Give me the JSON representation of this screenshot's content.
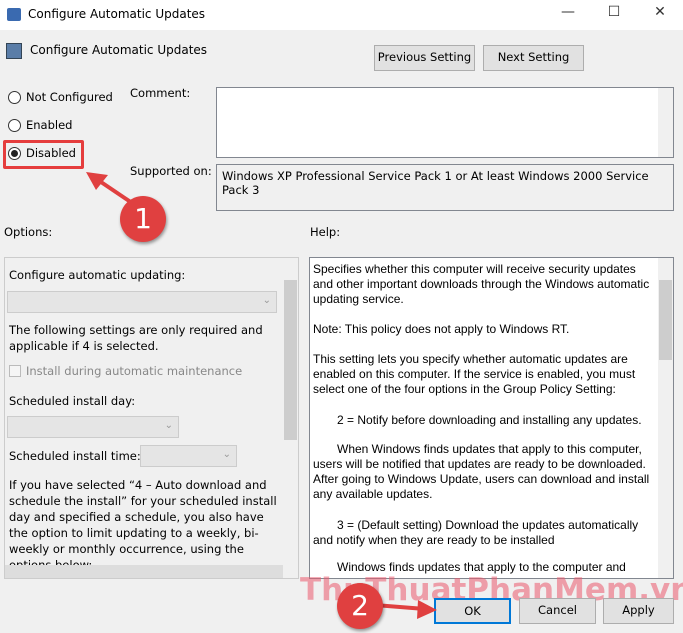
{
  "window": {
    "title": "Configure Automatic Updates",
    "minimize": "—",
    "maximize": "☐",
    "close": "✕"
  },
  "header": {
    "title": "Configure Automatic Updates",
    "prev": "Previous Setting",
    "next": "Next Setting"
  },
  "state": {
    "options": [
      {
        "label": "Not Configured",
        "checked": false
      },
      {
        "label": "Enabled",
        "checked": false
      },
      {
        "label": "Disabled",
        "checked": true
      }
    ]
  },
  "comment": {
    "label": "Comment:",
    "value": ""
  },
  "supported": {
    "label": "Supported on:",
    "value": "Windows XP Professional Service Pack 1 or At least Windows 2000 Service Pack 3"
  },
  "options": {
    "label": "Options:",
    "configure_label": "Configure automatic updating:",
    "note": "The following settings are only required and applicable if 4 is selected.",
    "maintenance": "Install during automatic maintenance",
    "day_label": "Scheduled install day:",
    "time_label": "Scheduled install time:",
    "paragraph": "If you have selected “4 – Auto download and schedule the install” for your scheduled install day and specified a schedule, you also have the option to limit updating to a weekly, bi-weekly or monthly occurrence, using the options below:"
  },
  "help": {
    "label": "Help:",
    "paragraphs": [
      "Specifies whether this computer will receive security updates and other important downloads through the Windows automatic updating service.",
      "Note: This policy does not apply to Windows RT.",
      "This setting lets you specify whether automatic updates are enabled on this computer. If the service is enabled, you must select one of the four options in the Group Policy Setting:",
      "2 = Notify before downloading and installing any updates.",
      "When Windows finds updates that apply to this computer, users will be notified that updates are ready to be downloaded. After going to Windows Update, users can download and install any available updates.",
      "3 = (Default setting) Download the updates automatically and notify when they are ready to be installed",
      "Windows finds updates that apply to the computer and"
    ]
  },
  "footer": {
    "ok": "OK",
    "cancel": "Cancel",
    "apply": "Apply"
  },
  "annotations": {
    "step1": "1",
    "step2": "2",
    "watermark": "ThuThuatPhanMem.vn"
  }
}
